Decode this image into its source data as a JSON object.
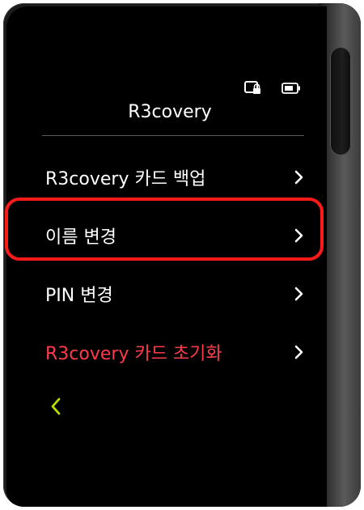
{
  "header": {
    "title": "R3covery",
    "status_icons": [
      {
        "name": "card-lock-icon"
      },
      {
        "name": "battery-icon"
      }
    ]
  },
  "menu": {
    "items": [
      {
        "label": "R3covery 카드 백업",
        "icon": "chevron-right-icon",
        "color": "#ffffff"
      },
      {
        "label": "이름 변경",
        "icon": "chevron-right-icon",
        "color": "#ffffff",
        "highlighted": true
      },
      {
        "label": "PIN 변경",
        "icon": "chevron-right-icon",
        "color": "#ffffff"
      },
      {
        "label": "R3covery 카드 초기화",
        "icon": "chevron-right-icon",
        "color": "#ff3b4a"
      }
    ]
  },
  "footer": {
    "back_icon": "chevron-left-icon",
    "back_color": "#b7e000"
  },
  "colors": {
    "highlight_border": "#ff1a1a",
    "screen_background": "#000000"
  }
}
